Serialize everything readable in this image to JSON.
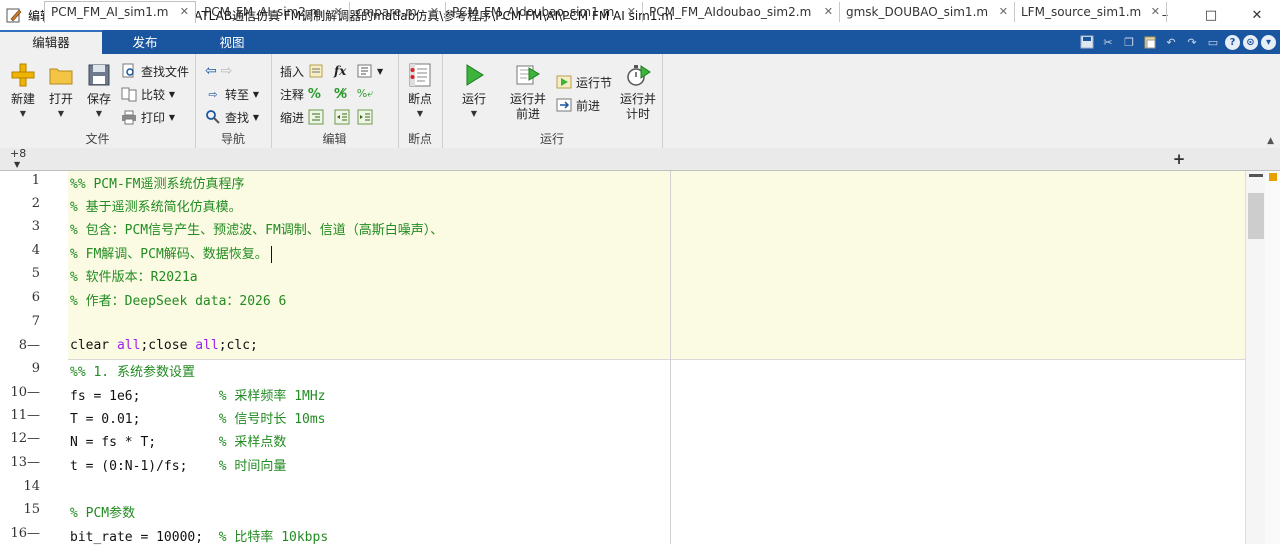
{
  "window": {
    "title": "编辑器 - E:\\毕业设计\\课题库\\MATLAB通信仿真 FM调制解调器的matlab仿真\\参考程序\\PCM FM\\AI\\PCM FM AI sim1.m",
    "minimize": "–",
    "maximize": "□",
    "close": "✕"
  },
  "ribbon_tabs": [
    "编辑器",
    "发布",
    "视图"
  ],
  "quick_access": [
    "save-icon",
    "cut-icon",
    "copy-icon",
    "paste-icon",
    "undo-icon",
    "redo-icon",
    "window-icon",
    "help-icon",
    "search-icon",
    "collapse-icon"
  ],
  "quick_access_help": "?",
  "groups": {
    "file": {
      "label": "文件",
      "new": "新建",
      "open": "打开",
      "save": "保存",
      "find_file": "查找文件",
      "compare": "比较",
      "print": "打印"
    },
    "nav": {
      "label": "导航",
      "goto": "转至",
      "find": "查找"
    },
    "edit": {
      "label": "编辑",
      "insert": "插入",
      "fx": "fx",
      "comment": "注释",
      "indent": "缩进"
    },
    "breakpoints": {
      "label": "断点",
      "breakpoints": "断点"
    },
    "run": {
      "label": "运行",
      "run": "运行",
      "run_advance": "运行并\n前进",
      "run_section": "运行节",
      "advance": "前进",
      "run_time": "运行并\n计时"
    }
  },
  "doc_tabs": {
    "overflow": "+8",
    "items": [
      "PCM_FM_AI_sim1.m",
      "PCM_FM_AI_sim2.m",
      "cmpare.m",
      "PCM_FM_AIdoubao_sim1.m",
      "PCM_FM_AIdoubao_sim2.m",
      "gmsk_DOUBAO_sim1.m",
      "LFM_source_sim1.m"
    ],
    "close": "✕",
    "add": "+"
  },
  "code_lines": [
    {
      "n": "1",
      "text": "%% PCM-FM遥测系统仿真程序"
    },
    {
      "n": "2",
      "text": "% 基于遥测系统简化仿真模。"
    },
    {
      "n": "3",
      "text": "% 包含：PCM信号产生、预滤波、FM调制、信道（高斯白噪声）、"
    },
    {
      "n": "4",
      "text": "% FM解调、PCM解码、数据恢复。"
    },
    {
      "n": "5",
      "text": "% 软件版本：R2021a"
    },
    {
      "n": "6",
      "text": "% 作者：DeepSeek data：2026 6"
    },
    {
      "n": "7",
      "text": ""
    },
    {
      "n": "8—",
      "a": "clear ",
      "b": "all",
      "c": ";close ",
      "d": "all",
      "e": ";clc;"
    },
    {
      "n": "9",
      "text": "%% 1. 系统参数设置"
    },
    {
      "n": "10—",
      "code": "fs = 1e6;          ",
      "comment": "% 采样频率 1MHz"
    },
    {
      "n": "11—",
      "code": "T = 0.01;          ",
      "comment": "% 信号时长 10ms"
    },
    {
      "n": "12—",
      "code": "N = fs * T;        ",
      "comment": "% 采样点数"
    },
    {
      "n": "13—",
      "code": "t = (0:N-1)/fs;    ",
      "comment": "% 时间向量"
    },
    {
      "n": "14",
      "text": ""
    },
    {
      "n": "15",
      "text": "% PCM参数"
    },
    {
      "n": "16—",
      "code": "bit_rate = 10000;  ",
      "comment": "% 比特率 10kbps"
    }
  ]
}
